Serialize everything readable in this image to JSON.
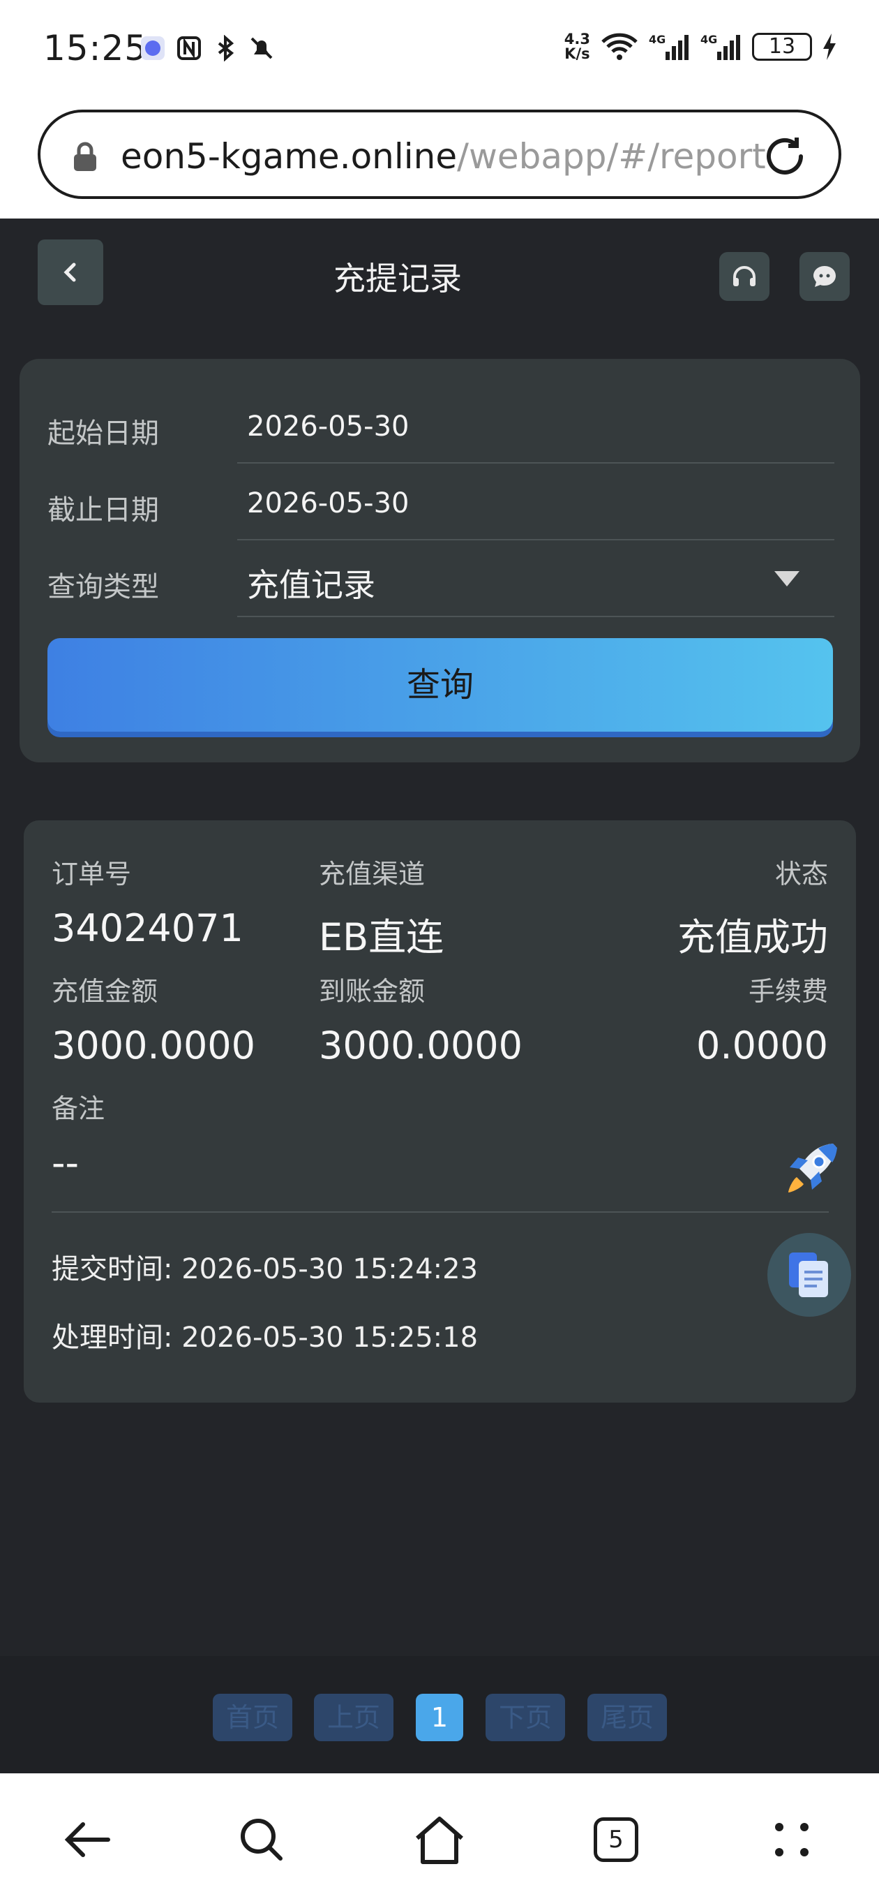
{
  "status_bar": {
    "time": "15:25",
    "net_speed_top": "4.3",
    "net_speed_bottom": "K/s",
    "battery": "13",
    "icons": [
      "app-icon",
      "nfc-icon",
      "bluetooth-icon",
      "mute-icon",
      "wifi-icon",
      "signal-4g-icon",
      "signal-4g-icon",
      "battery-icon",
      "charging-icon"
    ]
  },
  "browser": {
    "url_host": "eon5-kgame.online",
    "url_path": "/webapp/#/report",
    "tabs_count": "5"
  },
  "header": {
    "title": "充提记录"
  },
  "query": {
    "start_label": "起始日期",
    "start_value": "2026-05-30",
    "end_label": "截止日期",
    "end_value": "2026-05-30",
    "type_label": "查询类型",
    "type_value": "充值记录",
    "button": "查询"
  },
  "record": {
    "order_label": "订单号",
    "order_value": "34024071",
    "channel_label": "充值渠道",
    "channel_value": "EB直连",
    "status_label": "状态",
    "status_value": "充值成功",
    "amount_label": "充值金额",
    "amount_value": "3000.0000",
    "arrived_label": "到账金额",
    "arrived_value": "3000.0000",
    "fee_label": "手续费",
    "fee_value": "0.0000",
    "remark_label": "备注",
    "remark_value": "--",
    "submit_time": "提交时间: 2026-05-30 15:24:23",
    "process_time": "处理时间: 2026-05-30 15:25:18"
  },
  "pager": {
    "first": "首页",
    "prev": "上页",
    "current": "1",
    "next": "下页",
    "last": "尾页"
  },
  "colors": {
    "background": "#232529",
    "card": "#343a3c",
    "accent_start": "#3e80e3",
    "accent_end": "#55c3ee"
  }
}
